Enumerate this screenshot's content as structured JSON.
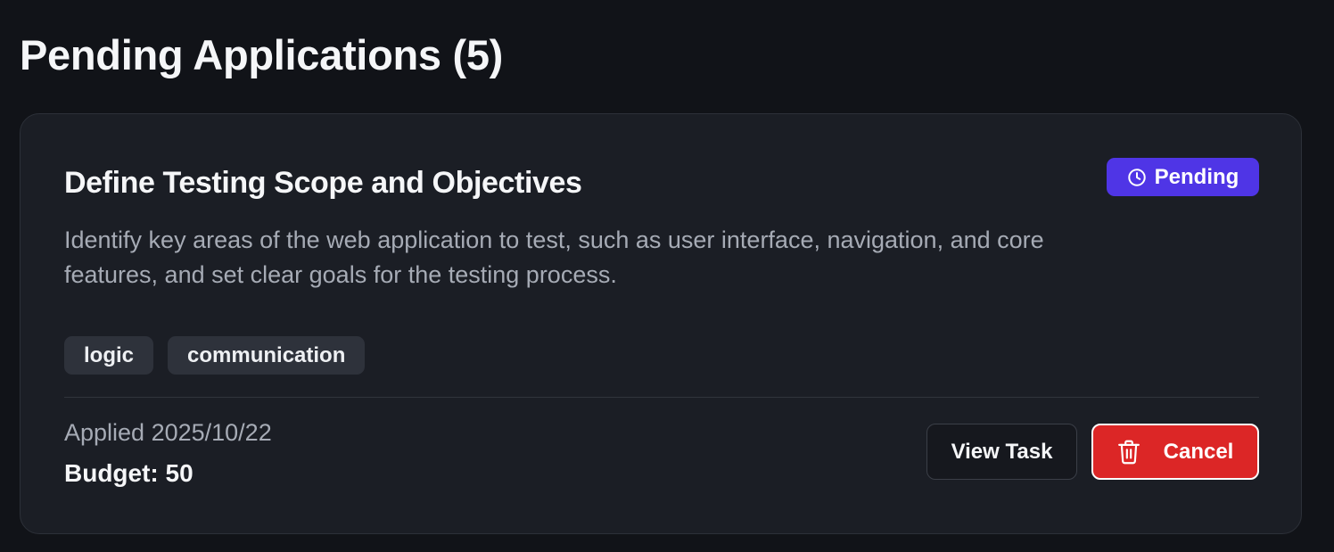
{
  "header": {
    "title": "Pending Applications (5)"
  },
  "application": {
    "title": "Define Testing Scope and Objectives",
    "status": {
      "label": "Pending",
      "icon": "clock-icon",
      "color": "#4f35e6"
    },
    "description": "Identify key areas of the web application to test, such as user interface, navigation, and core features, and set clear goals for the testing process.",
    "tags": [
      "logic",
      "communication"
    ],
    "applied": "Applied 2025/10/22",
    "budget": "Budget: 50",
    "actions": {
      "view_label": "View Task",
      "cancel_label": "Cancel",
      "cancel_icon": "trash-icon",
      "cancel_color": "#dc2626"
    }
  }
}
